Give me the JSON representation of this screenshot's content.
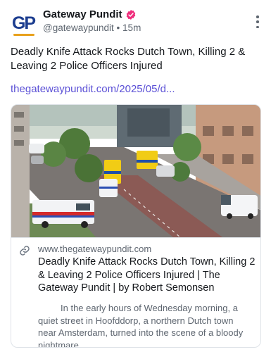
{
  "author": {
    "display_name": "Gateway Pundit",
    "handle": "@gatewaypundit",
    "separator": "•",
    "time": "15m",
    "avatar_text": "GP",
    "verified_color": "#ef2e7c"
  },
  "post": {
    "text": "Deadly Knife Attack Rocks Dutch Town, Killing 2 & Leaving 2 Police Officers Injured",
    "link": "thegatewaypundit.com/2025/05/d..."
  },
  "card": {
    "domain": "www.thegatewaypundit.com",
    "title": "Deadly Knife Attack Rocks Dutch Town, Killing 2 & Leaving 2 Police Officers Injured | The Gateway Pundit | by Robert Semonsen",
    "description": "In the early hours of Wednesday morning, a quiet street in Hoofddorp, a northern Dutch town near Amsterdam, turned into the scene of a bloody nightmare."
  },
  "icons": {
    "verified": "verified-badge-icon",
    "more": "more-vertical-icon",
    "link": "link-icon"
  },
  "colors": {
    "link": "#5b50d6",
    "brand_blue": "#1c3d8f",
    "brand_orange": "#e8a11c"
  }
}
